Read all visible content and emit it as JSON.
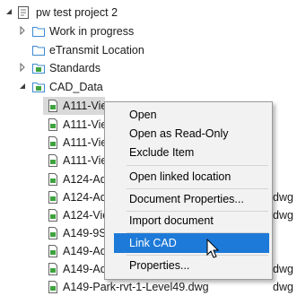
{
  "tree": {
    "root": "pw test project 2",
    "folders": {
      "work_in_progress": "Work in progress",
      "etransmit": "eTransmit Location",
      "standards": "Standards",
      "cad_data": "CAD_Data"
    },
    "files": [
      {
        "name": "A111-Vie",
        "suffix": ""
      },
      {
        "name": "A111-Vie",
        "suffix": ""
      },
      {
        "name": "A111-Vie",
        "suffix": ""
      },
      {
        "name": "A111-Vie",
        "suffix": ""
      },
      {
        "name": "A124-Ad",
        "suffix": "dwg"
      },
      {
        "name": "A124-Ad",
        "suffix": "dwg"
      },
      {
        "name": "A124-Vie",
        "suffix": ""
      },
      {
        "name": "A149-9S",
        "suffix": ""
      },
      {
        "name": "A149-Ad",
        "suffix": "dwg"
      },
      {
        "name": "A149-Ad",
        "suffix": "dwg"
      },
      {
        "name": "A149-Park-rvt-1-Level49.dwg",
        "suffix": ""
      }
    ]
  },
  "context_menu": {
    "open": "Open",
    "open_read_only": "Open as Read-Only",
    "exclude_item": "Exclude Item",
    "open_linked_location": "Open linked location",
    "document_properties": "Document Properties...",
    "import_document": "Import document",
    "link_cad": "Link CAD",
    "properties": "Properties..."
  },
  "colors": {
    "highlight": "#1e7ad8",
    "selected_row": "#d9d9d9",
    "folder_outline": "#3c8bd1",
    "file_green": "#3ea33e"
  }
}
